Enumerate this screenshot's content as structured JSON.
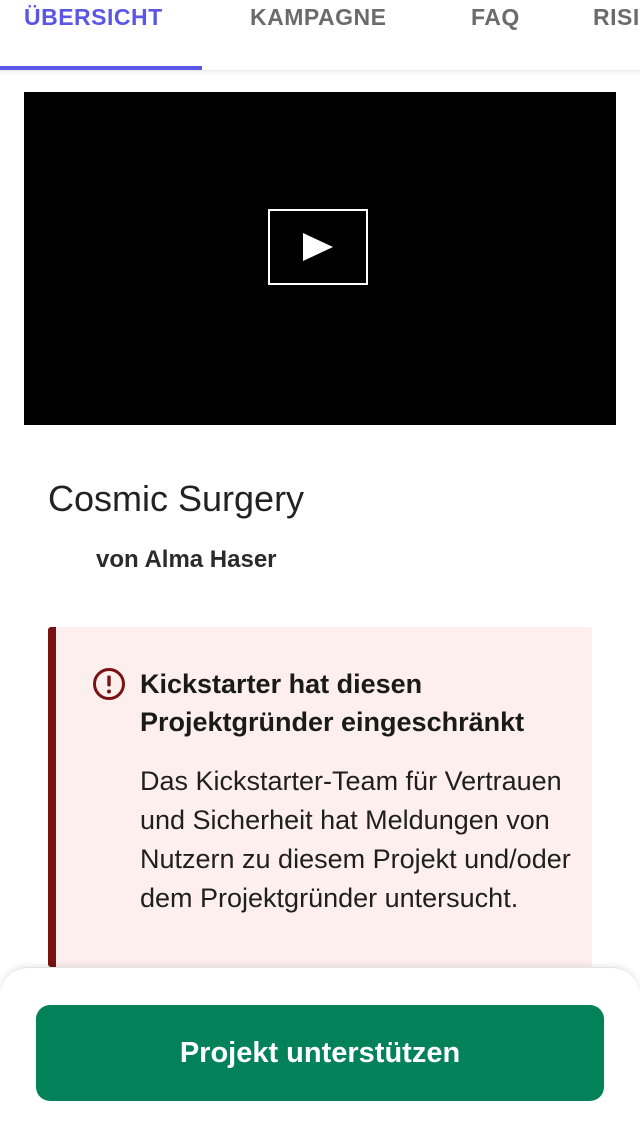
{
  "tabs": [
    {
      "label": "ÜBERSICHT",
      "active": true
    },
    {
      "label": "KAMPAGNE",
      "active": false
    },
    {
      "label": "FAQ",
      "active": false
    },
    {
      "label": "RISIKEN",
      "active": false
    }
  ],
  "video": {
    "icon": "play-icon"
  },
  "project": {
    "title": "Cosmic Surgery",
    "byline": "von Alma Haser"
  },
  "warning": {
    "icon": "alert-circle-icon",
    "heading": "Kickstarter hat diesen Projektgründer eingeschränkt",
    "body": "Das Kickstarter-Team für Vertrauen und Sicherheit hat Meldungen von Nutzern zu diesem Projekt und/oder dem Projektgründer untersucht.",
    "accent_color": "#7a1212",
    "background_color": "#fcefed"
  },
  "cta": {
    "label": "Projekt unterstützen",
    "color": "#038259"
  },
  "colors": {
    "tab_active": "#5b56e5",
    "tab_inactive": "#6b6b6b"
  }
}
